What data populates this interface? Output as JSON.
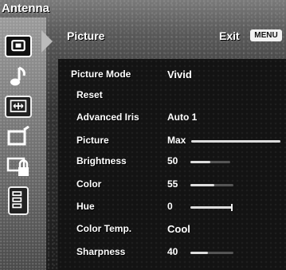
{
  "top_label": "Antenna",
  "header": {
    "title": "Picture",
    "exit_label": "Exit",
    "menu_key": "MENU"
  },
  "sidebar": {
    "items": [
      {
        "icon": "picture-icon",
        "active": true
      },
      {
        "icon": "music-note-icon",
        "active": false
      },
      {
        "icon": "screen-size-icon",
        "active": false
      },
      {
        "icon": "tv-setup-icon",
        "active": false
      },
      {
        "icon": "parental-lock-icon",
        "active": false
      },
      {
        "icon": "menu-list-icon",
        "active": false
      }
    ]
  },
  "settings": [
    {
      "label": "Picture Mode",
      "value": "Vivid"
    },
    {
      "label": "Reset",
      "value": ""
    },
    {
      "label": "Advanced Iris",
      "value": "Auto 1"
    },
    {
      "label": "Picture",
      "value": "Max",
      "level": 1.0
    },
    {
      "label": "Brightness",
      "value": "50",
      "level": 0.5
    },
    {
      "label": "Color",
      "value": "55",
      "level": 0.55
    },
    {
      "label": "Hue",
      "value": "0",
      "level": 0.5
    },
    {
      "label": "Color Temp.",
      "value": "Cool"
    },
    {
      "label": "Sharpness",
      "value": "40",
      "level": 0.4
    }
  ]
}
